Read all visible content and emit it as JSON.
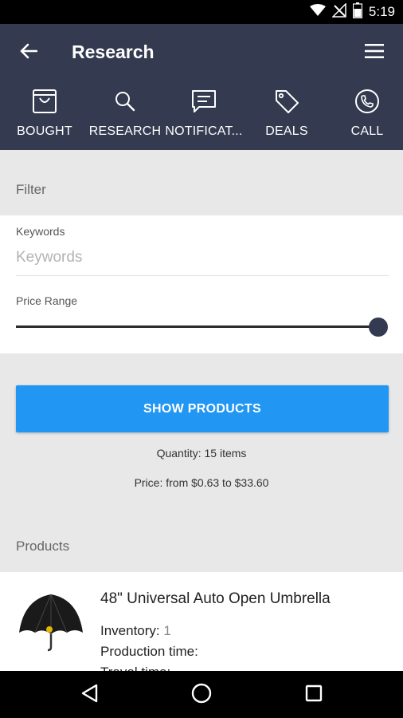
{
  "status_bar": {
    "time": "5:19",
    "icons": [
      "wifi-icon",
      "no-signal-icon",
      "battery-icon"
    ]
  },
  "app_bar": {
    "title": "Research",
    "back_icon": "arrow-left-icon",
    "menu_icon": "hamburger-menu-icon"
  },
  "tabs": [
    {
      "label": "BOUGHT",
      "icon": "shopping-bag-icon"
    },
    {
      "label": "RESEARCH",
      "icon": "search-icon"
    },
    {
      "label": "NOTIFICAT...",
      "icon": "message-icon"
    },
    {
      "label": "DEALS",
      "icon": "tag-icon"
    },
    {
      "label": "CALL",
      "icon": "phone-icon"
    }
  ],
  "filter": {
    "header": "Filter",
    "keywords_label": "Keywords",
    "keywords_placeholder": "Keywords",
    "keywords_value": "",
    "price_range_label": "Price Range",
    "price_range_level": 1.0
  },
  "actions": {
    "show_products": "SHOW PRODUCTS",
    "quantity": "Quantity: 15 items",
    "price": "Price: from $0.63 to $33.60"
  },
  "products": {
    "header": "Products",
    "items": [
      {
        "title": "48\" Universal Auto Open Umbrella",
        "inventory_label": "Inventory:",
        "inventory_value": "1",
        "production_label": "Production time:",
        "travel_label": "Travel time:"
      }
    ]
  },
  "nav": {
    "back_icon": "nav-back-icon",
    "home_icon": "nav-home-icon",
    "recents_icon": "nav-recents-icon"
  },
  "colors": {
    "app_bar": "#343a4f",
    "accent": "#2196f3",
    "background": "#e8e8e8"
  }
}
